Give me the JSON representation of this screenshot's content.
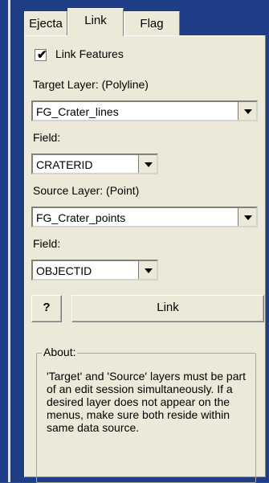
{
  "tabs": [
    {
      "label": "Ejecta"
    },
    {
      "label": "Link"
    },
    {
      "label": "Flag"
    }
  ],
  "link_features": {
    "label": "Link Features",
    "checked": true
  },
  "target": {
    "layer_label": "Target Layer: (Polyline)",
    "layer_value": "FG_Crater_lines",
    "field_label": "Field:",
    "field_value": "CRATERID"
  },
  "source": {
    "layer_label": "Source Layer: (Point)",
    "layer_value": "FG_Crater_points",
    "field_label": "Field:",
    "field_value": "OBJECTID"
  },
  "buttons": {
    "help": "?",
    "link": "Link"
  },
  "about": {
    "title": "About:",
    "text": "'Target' and 'Source' layers must be part of an edit session simultaneously. If a desired layer does not appear on the menus, make sure both reside within same data source."
  }
}
